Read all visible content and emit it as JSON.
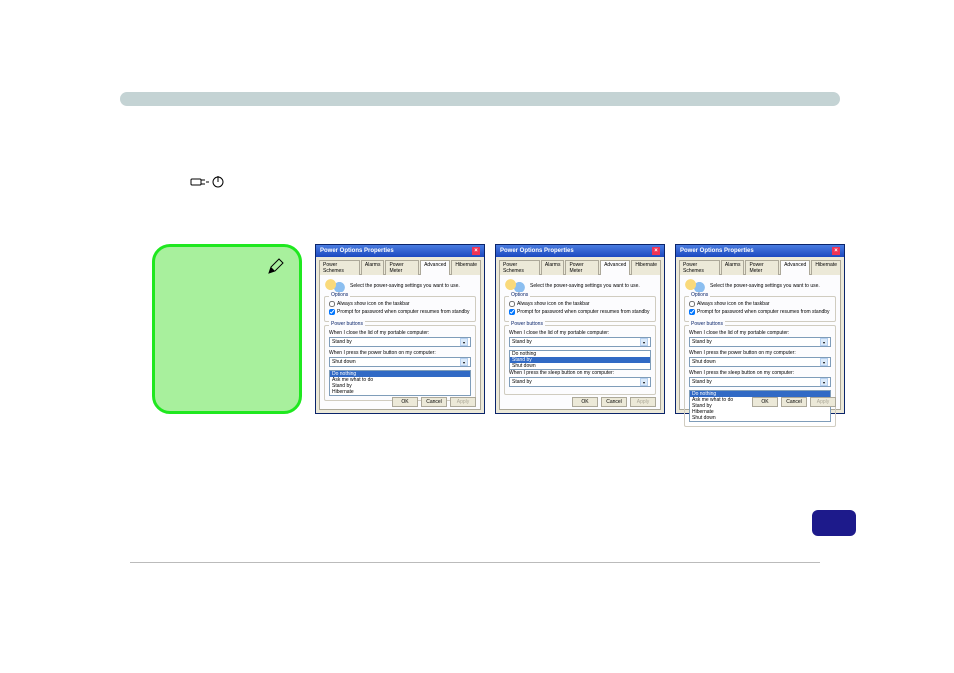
{
  "header": {
    "bar_label": ""
  },
  "main": {
    "text_line": "",
    "icon_name": "power-plug-icon"
  },
  "note": {
    "icon": "pencil-icon",
    "body": ""
  },
  "dialogs": [
    {
      "title": "Power Options Properties",
      "tabs": [
        "Power Schemes",
        "Alarms",
        "Power Meter",
        "Advanced",
        "Hibernate"
      ],
      "active_tab": 3,
      "instruction": "Select the power-saving settings you want to use.",
      "options_group": "Options",
      "check_taskbar": "Always show icon on the taskbar",
      "check_password": "Prompt for password when computer resumes from standby",
      "check_password_checked": true,
      "power_group": "Power buttons",
      "lid_label": "When I close the lid of my portable computer:",
      "lid_value": "Stand by",
      "power_label": "When I press the power button on my computer:",
      "power_value": "Shut down",
      "list_options": [
        "Do nothing",
        "Ask me what to do",
        "Stand by",
        "Hibernate"
      ],
      "buttons": {
        "ok": "OK",
        "cancel": "Cancel",
        "apply": "Apply"
      }
    },
    {
      "title": "Power Options Properties",
      "tabs": [
        "Power Schemes",
        "Alarms",
        "Power Meter",
        "Advanced",
        "Hibernate"
      ],
      "active_tab": 3,
      "instruction": "Select the power-saving settings you want to use.",
      "options_group": "Options",
      "check_taskbar": "Always show icon on the taskbar",
      "check_password": "Prompt for password when computer resumes from standby",
      "check_password_checked": true,
      "power_group": "Power buttons",
      "lid_label": "When I close the lid of my portable computer:",
      "lid_value": "Stand by",
      "lid_list": [
        "Do nothing",
        "Stand by",
        "Shut down"
      ],
      "sleep_label": "When I press the sleep button on my computer:",
      "sleep_value": "Stand by",
      "buttons": {
        "ok": "OK",
        "cancel": "Cancel",
        "apply": "Apply"
      }
    },
    {
      "title": "Power Options Properties",
      "tabs": [
        "Power Schemes",
        "Alarms",
        "Power Meter",
        "Advanced",
        "Hibernate"
      ],
      "active_tab": 3,
      "instruction": "Select the power-saving settings you want to use.",
      "options_group": "Options",
      "check_taskbar": "Always show icon on the taskbar",
      "check_password": "Prompt for password when computer resumes from standby",
      "check_password_checked": true,
      "power_group": "Power buttons",
      "lid_label": "When I close the lid of my portable computer:",
      "lid_value": "Stand by",
      "power_label": "When I press the power button on my computer:",
      "power_value": "Shut down",
      "sleep_label": "When I press the sleep button on my computer:",
      "sleep_value": "Stand by",
      "list_options": [
        "Do nothing",
        "Ask me what to do",
        "Stand by",
        "Hibernate",
        "Shut down"
      ],
      "buttons": {
        "ok": "OK",
        "cancel": "Cancel",
        "apply": "Apply"
      }
    }
  ],
  "footer": {
    "badge": ""
  }
}
